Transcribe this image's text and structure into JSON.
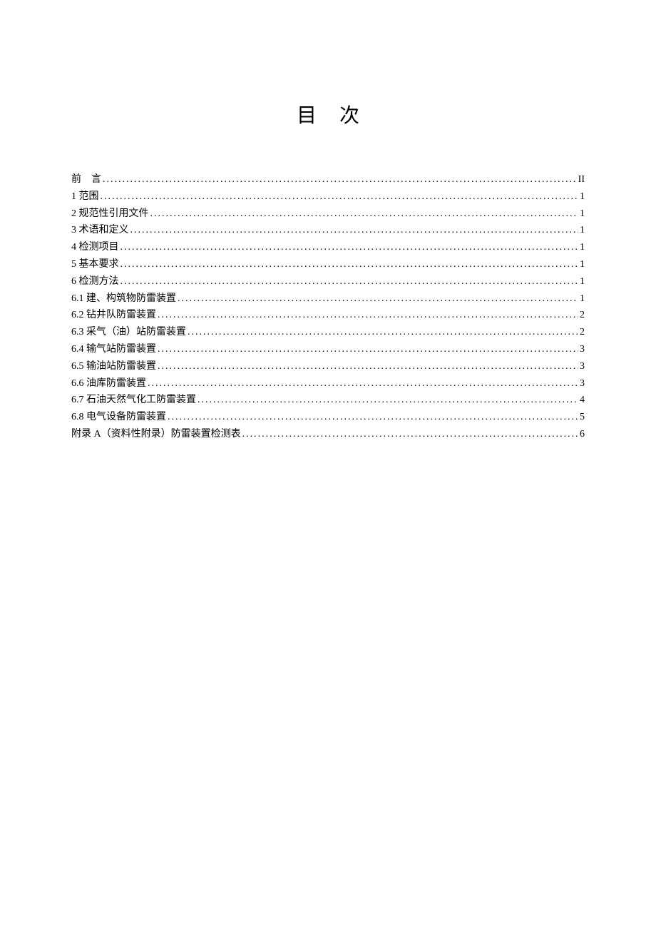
{
  "title": "目次",
  "toc": [
    {
      "label": "前　言",
      "page": "II",
      "spaced": false
    },
    {
      "label": "1 范围",
      "page": "1",
      "spaced": false
    },
    {
      "label": "2 规范性引用文件",
      "page": "1",
      "spaced": false
    },
    {
      "label": "3 术语和定义",
      "page": "1",
      "spaced": false
    },
    {
      "label": "4 检测项目",
      "page": "1",
      "spaced": false
    },
    {
      "label": "5 基本要求",
      "page": "1",
      "spaced": false
    },
    {
      "label": "6 检测方法",
      "page": "1",
      "spaced": false
    },
    {
      "label": "6.1 建、构筑物防雷装置",
      "page": "1",
      "spaced": false
    },
    {
      "label": "6.2 钻井队防雷装置",
      "page": "2",
      "spaced": false
    },
    {
      "label": "6.3 采气（油）站防雷装置",
      "page": "2",
      "spaced": false
    },
    {
      "label": "6.4 输气站防雷装置",
      "page": "3",
      "spaced": false
    },
    {
      "label": "6.5 输油站防雷装置",
      "page": "3",
      "spaced": false
    },
    {
      "label": "6.6 油库防雷装置",
      "page": "3",
      "spaced": false
    },
    {
      "label": "6.7 石油天然气化工防雷装置",
      "page": "4",
      "spaced": false
    },
    {
      "label": "6.8 电气设备防雷装置",
      "page": "5",
      "spaced": false
    },
    {
      "label": "附录 A（资料性附录）防雷装置检测表",
      "page": "6",
      "spaced": false
    }
  ]
}
